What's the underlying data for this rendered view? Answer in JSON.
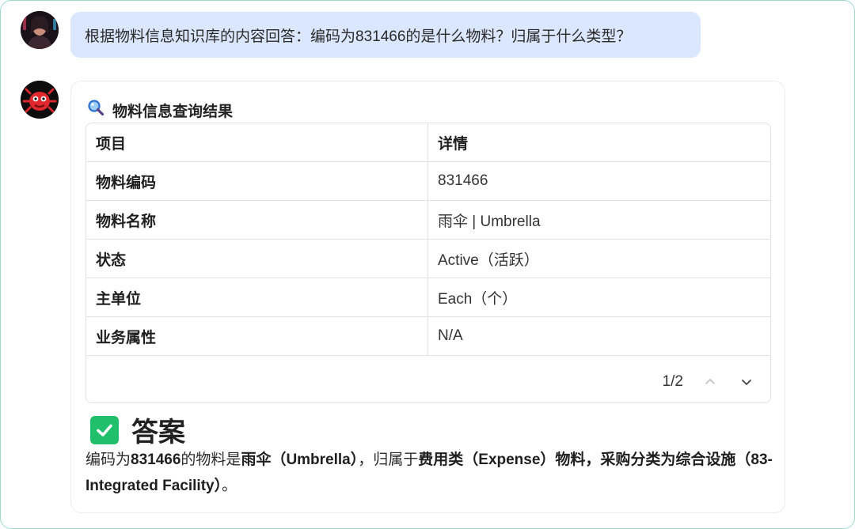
{
  "user_message": {
    "text": "根据物料信息知识库的内容回答：编码为831466的是什么物料？归属于什么类型？"
  },
  "result": {
    "title": "物料信息查询结果",
    "icon": "magnifier-icon",
    "headers": [
      "项目",
      "详情"
    ],
    "rows": [
      [
        "物料编码",
        "831466"
      ],
      [
        "物料名称",
        "雨伞 | Umbrella"
      ],
      [
        "状态",
        "Active（活跃）"
      ],
      [
        "主单位",
        "Each（个）"
      ],
      [
        "业务属性",
        "N/A"
      ]
    ],
    "pager": {
      "text": "1/2"
    }
  },
  "answer": {
    "title": "答案",
    "parts": {
      "p1": "编码为",
      "p2": "831466",
      "p3": "的物料是",
      "p4": "雨伞（Umbrella）",
      "p5": "，归属于",
      "p6": "费用类（Expense）物料，采购分类为综合设施（83-Integrated Facility）",
      "p7": "。"
    }
  },
  "colors": {
    "user_bubble": "#dbe6ff",
    "check_green": "#1fbf6b",
    "frame_border": "#9fd8cf"
  }
}
